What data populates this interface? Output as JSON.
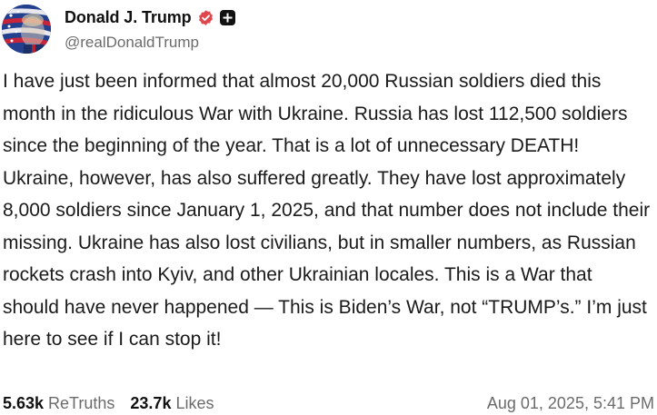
{
  "author": {
    "display_name": "Donald J. Trump",
    "handle": "@realDonaldTrump",
    "avatar_icon": "profile-avatar-flag",
    "verified_icon": "verified-badge-icon",
    "verified_color": "#e0474c",
    "plus_icon": "plus-badge-icon"
  },
  "post": {
    "text": "I have just been informed that almost 20,000 Russian soldiers died this month in the ridiculous War with Ukraine. Russia has lost 112,500 soldiers since the beginning of the year. That is a lot of unnecessary DEATH! Ukraine, however, has also suffered greatly. They have lost approximately 8,000 soldiers since January 1, 2025, and that number does not include their missing. Ukraine has also lost civilians, but in smaller numbers, as Russian rockets crash into Kyiv, and other Ukrainian locales. This is a War that should have never happened — This is Biden’s War, not “TRUMP’s.” I’m just here to see if I can stop it!"
  },
  "stats": {
    "retruths_count": "5.63k",
    "retruths_label": "ReTruths",
    "likes_count": "23.7k",
    "likes_label": "Likes"
  },
  "timestamp": "Aug 01, 2025, 5:41 PM",
  "colors": {
    "text": "#1a1a1a",
    "muted": "#6b6b6b",
    "badge_red": "#e0474c"
  }
}
